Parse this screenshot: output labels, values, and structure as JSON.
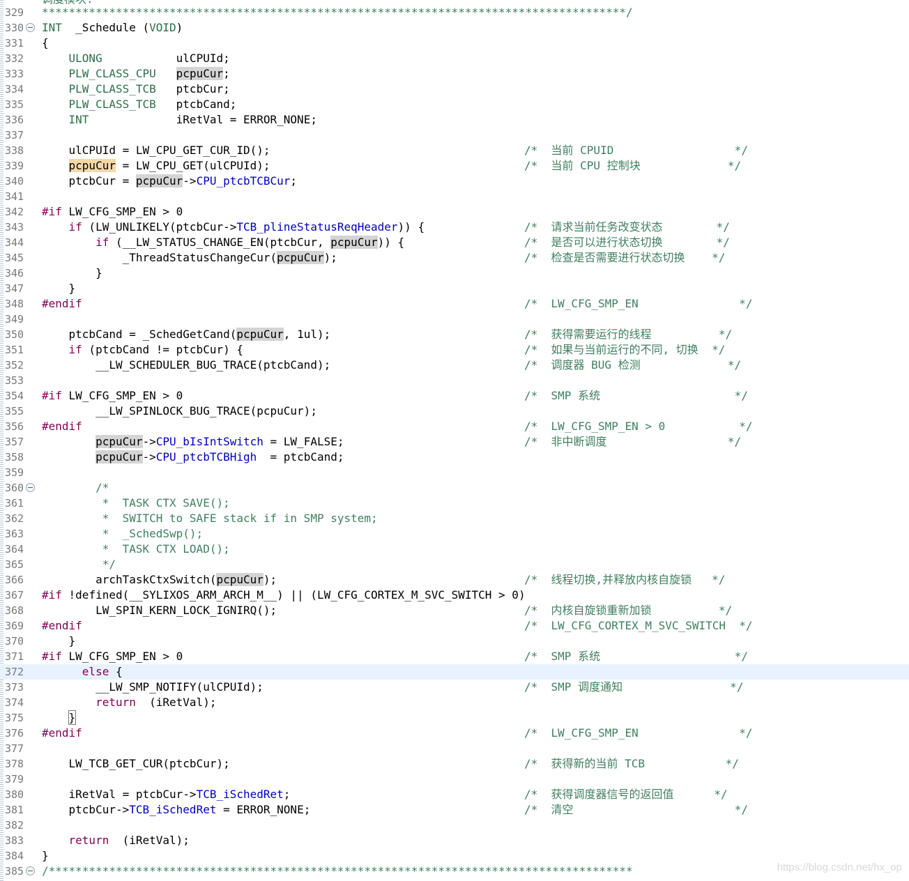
{
  "editor": {
    "top_fragment": "调度模块.",
    "lines": [
      {
        "n": "329",
        "code": "***************************************************************************************/",
        "comment": "",
        "fold": false,
        "current": false,
        "kind": "stars"
      },
      {
        "n": "330",
        "code": "INT  _Schedule (VOID)",
        "comment": "",
        "fold": true,
        "current": false
      },
      {
        "n": "331",
        "code": "{",
        "comment": "",
        "fold": false,
        "current": false
      },
      {
        "n": "332",
        "code": "    ULONG           ulCPUId;",
        "comment": "",
        "fold": false,
        "current": false
      },
      {
        "n": "333",
        "code": "    PLW_CLASS_CPU   pcpuCur;",
        "comment": "",
        "fold": false,
        "current": false
      },
      {
        "n": "334",
        "code": "    PLW_CLASS_TCB   ptcbCur;",
        "comment": "",
        "fold": false,
        "current": false
      },
      {
        "n": "335",
        "code": "    PLW_CLASS_TCB   ptcbCand;",
        "comment": "",
        "fold": false,
        "current": false
      },
      {
        "n": "336",
        "code": "    INT             iRetVal = ERROR_NONE;",
        "comment": "",
        "fold": false,
        "current": false
      },
      {
        "n": "337",
        "code": "",
        "comment": "",
        "fold": false,
        "current": false
      },
      {
        "n": "338",
        "code": "    ulCPUId = LW_CPU_GET_CUR_ID();",
        "comment": "/*  当前 CPUID                  */",
        "fold": false,
        "current": false
      },
      {
        "n": "339",
        "code": "    pcpuCur = LW_CPU_GET(ulCPUId);",
        "comment": "/*  当前 CPU 控制块             */",
        "fold": false,
        "current": false
      },
      {
        "n": "340",
        "code": "    ptcbCur = pcpuCur->CPU_ptcbTCBCur;",
        "comment": "",
        "fold": false,
        "current": false
      },
      {
        "n": "341",
        "code": "",
        "comment": "",
        "fold": false,
        "current": false
      },
      {
        "n": "342",
        "code": "#if LW_CFG_SMP_EN > 0",
        "comment": "",
        "fold": false,
        "current": false
      },
      {
        "n": "343",
        "code": "    if (LW_UNLIKELY(ptcbCur->TCB_plineStatusReqHeader)) {",
        "comment": "/*  请求当前任务改变状态        */",
        "fold": false,
        "current": false
      },
      {
        "n": "344",
        "code": "        if (__LW_STATUS_CHANGE_EN(ptcbCur, pcpuCur)) {",
        "comment": "/*  是否可以进行状态切换        */",
        "fold": false,
        "current": false
      },
      {
        "n": "345",
        "code": "            _ThreadStatusChangeCur(pcpuCur);",
        "comment": "/*  检查是否需要进行状态切换    */",
        "fold": false,
        "current": false
      },
      {
        "n": "346",
        "code": "        }",
        "comment": "",
        "fold": false,
        "current": false
      },
      {
        "n": "347",
        "code": "    }",
        "comment": "",
        "fold": false,
        "current": false
      },
      {
        "n": "348",
        "code": "#endif",
        "comment": "/*  LW_CFG_SMP_EN               */",
        "fold": false,
        "current": false
      },
      {
        "n": "349",
        "code": "",
        "comment": "",
        "fold": false,
        "current": false
      },
      {
        "n": "350",
        "code": "    ptcbCand = _SchedGetCand(pcpuCur, 1ul);",
        "comment": "/*  获得需要运行的线程          */",
        "fold": false,
        "current": false
      },
      {
        "n": "351",
        "code": "    if (ptcbCand != ptcbCur) {",
        "comment": "/*  如果与当前运行的不同, 切换  */",
        "fold": false,
        "current": false
      },
      {
        "n": "352",
        "code": "        __LW_SCHEDULER_BUG_TRACE(ptcbCand);",
        "comment": "/*  调度器 BUG 检测             */",
        "fold": false,
        "current": false
      },
      {
        "n": "353",
        "code": "",
        "comment": "",
        "fold": false,
        "current": false
      },
      {
        "n": "354",
        "code": "#if LW_CFG_SMP_EN > 0",
        "comment": "/*  SMP 系统                    */",
        "fold": false,
        "current": false
      },
      {
        "n": "355",
        "code": "        __LW_SPINLOCK_BUG_TRACE(pcpuCur);",
        "comment": "",
        "fold": false,
        "current": false
      },
      {
        "n": "356",
        "code": "#endif",
        "comment": "/*  LW_CFG_SMP_EN > 0           */",
        "fold": false,
        "current": false
      },
      {
        "n": "357",
        "code": "        pcpuCur->CPU_bIsIntSwitch = LW_FALSE;",
        "comment": "/*  非中断调度                  */",
        "fold": false,
        "current": false
      },
      {
        "n": "358",
        "code": "        pcpuCur->CPU_ptcbTCBHigh  = ptcbCand;",
        "comment": "",
        "fold": false,
        "current": false
      },
      {
        "n": "359",
        "code": "",
        "comment": "",
        "fold": false,
        "current": false
      },
      {
        "n": "360",
        "code": "        /*",
        "comment": "",
        "fold": true,
        "current": false
      },
      {
        "n": "361",
        "code": "         *  TASK CTX SAVE();",
        "comment": "",
        "fold": false,
        "current": false
      },
      {
        "n": "362",
        "code": "         *  SWITCH to SAFE stack if in SMP system;",
        "comment": "",
        "fold": false,
        "current": false
      },
      {
        "n": "363",
        "code": "         *  _SchedSwp();",
        "comment": "",
        "fold": false,
        "current": false
      },
      {
        "n": "364",
        "code": "         *  TASK CTX LOAD();",
        "comment": "",
        "fold": false,
        "current": false
      },
      {
        "n": "365",
        "code": "         */",
        "comment": "",
        "fold": false,
        "current": false
      },
      {
        "n": "366",
        "code": "        archTaskCtxSwitch(pcpuCur);",
        "comment": "/*  线程切换,并释放内核自旋锁   */",
        "fold": false,
        "current": false
      },
      {
        "n": "367",
        "code": "#if !defined(__SYLIXOS_ARM_ARCH_M__) || (LW_CFG_CORTEX_M_SVC_SWITCH > 0)",
        "comment": "",
        "fold": false,
        "current": false
      },
      {
        "n": "368",
        "code": "        LW_SPIN_KERN_LOCK_IGNIRQ();",
        "comment": "/*  内核自旋锁重新加锁          */",
        "fold": false,
        "current": false
      },
      {
        "n": "369",
        "code": "#endif",
        "comment": "/*  LW_CFG_CORTEX_M_SVC_SWITCH  */",
        "fold": false,
        "current": false
      },
      {
        "n": "370",
        "code": "    }",
        "comment": "",
        "fold": false,
        "current": false
      },
      {
        "n": "371",
        "code": "#if LW_CFG_SMP_EN > 0",
        "comment": "/*  SMP 系统                    */",
        "fold": false,
        "current": false
      },
      {
        "n": "372",
        "code": "      else {",
        "comment": "",
        "fold": false,
        "current": true
      },
      {
        "n": "373",
        "code": "        __LW_SMP_NOTIFY(ulCPUId);",
        "comment": "/*  SMP 调度通知                */",
        "fold": false,
        "current": false
      },
      {
        "n": "374",
        "code": "        return  (iRetVal);",
        "comment": "",
        "fold": false,
        "current": false
      },
      {
        "n": "375",
        "code": "    }",
        "comment": "",
        "fold": false,
        "current": false
      },
      {
        "n": "376",
        "code": "#endif",
        "comment": "/*  LW_CFG_SMP_EN               */",
        "fold": false,
        "current": false
      },
      {
        "n": "377",
        "code": "",
        "comment": "",
        "fold": false,
        "current": false
      },
      {
        "n": "378",
        "code": "    LW_TCB_GET_CUR(ptcbCur);",
        "comment": "/*  获得新的当前 TCB            */",
        "fold": false,
        "current": false
      },
      {
        "n": "379",
        "code": "",
        "comment": "",
        "fold": false,
        "current": false
      },
      {
        "n": "380",
        "code": "    iRetVal = ptcbCur->TCB_iSchedRet;",
        "comment": "/*  获得调度器信号的返回值      */",
        "fold": false,
        "current": false
      },
      {
        "n": "381",
        "code": "    ptcbCur->TCB_iSchedRet = ERROR_NONE;",
        "comment": "/*  清空                        */",
        "fold": false,
        "current": false
      },
      {
        "n": "382",
        "code": "",
        "comment": "",
        "fold": false,
        "current": false
      },
      {
        "n": "383",
        "code": "    return  (iRetVal);",
        "comment": "",
        "fold": false,
        "current": false
      },
      {
        "n": "384",
        "code": "}",
        "comment": "",
        "fold": false,
        "current": false
      },
      {
        "n": "385",
        "code": "/***************************************************************************************",
        "comment": "",
        "fold": true,
        "current": false,
        "kind": "stars"
      }
    ]
  },
  "watermark": "https://blog.csdn.net/hx_op",
  "colors": {
    "comment": "#3f7f5f",
    "keyword": "#7f0055",
    "type": "#2c6e49",
    "field": "#0000c0",
    "occurrence_highlight": "#d4d4d4",
    "selection_highlight": "#f5d8a8",
    "current_line": "#e8f2fe"
  }
}
